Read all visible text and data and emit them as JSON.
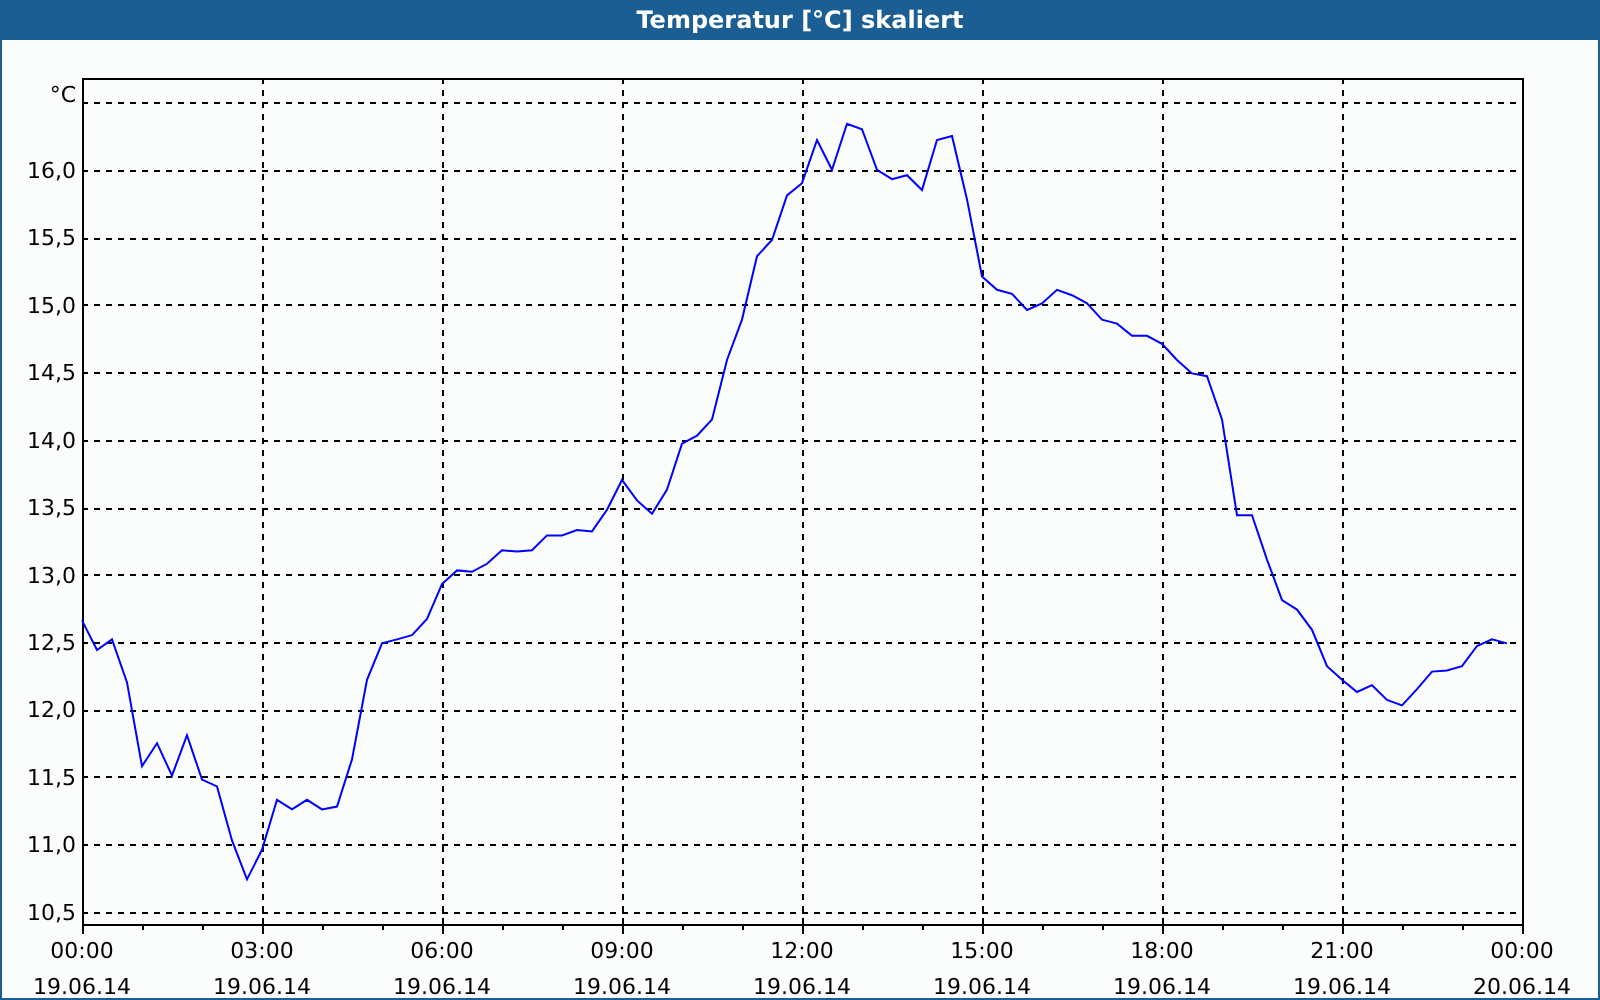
{
  "window": {
    "title": "Temperatur [°C] skaliert"
  },
  "chart": {
    "chart_data": {
      "type": "line",
      "grid": true,
      "ylabel": "°C",
      "ylim": [
        10.41,
        16.68
      ],
      "yticks": [
        {
          "value": 10.5,
          "label": "10,5"
        },
        {
          "value": 11,
          "label": "11,0"
        },
        {
          "value": 11.5,
          "label": "11,5"
        },
        {
          "value": 12,
          "label": "12,0"
        },
        {
          "value": 12.5,
          "label": "12,5"
        },
        {
          "value": 13,
          "label": "13,0"
        },
        {
          "value": 13.5,
          "label": "13,5"
        },
        {
          "value": 14,
          "label": "14,0"
        },
        {
          "value": 14.5,
          "label": "14,5"
        },
        {
          "value": 15,
          "label": "15,0"
        },
        {
          "value": 15.5,
          "label": "15,5"
        },
        {
          "value": 16,
          "label": "16,0"
        }
      ],
      "categories": [
        "00:00\n19.06.14",
        null,
        null,
        null,
        null,
        null,
        null,
        null,
        null,
        null,
        null,
        null,
        "03:00\n19.06.14",
        null,
        null,
        null,
        null,
        null,
        null,
        null,
        null,
        null,
        null,
        null,
        "06:00\n19.06.14",
        null,
        null,
        null,
        null,
        null,
        null,
        null,
        null,
        null,
        null,
        null,
        "09:00\n19.06.14",
        null,
        null,
        null,
        null,
        null,
        null,
        null,
        null,
        null,
        null,
        null,
        "12:00\n19.06.14",
        null,
        null,
        null,
        null,
        null,
        null,
        null,
        null,
        null,
        null,
        null,
        "15:00\n19.06.14",
        null,
        null,
        null,
        null,
        null,
        null,
        null,
        null,
        null,
        null,
        null,
        "18:00\n19.06.14",
        null,
        null,
        null,
        null,
        null,
        null,
        null,
        null,
        null,
        null,
        null,
        "21:00\n19.06.14",
        null,
        null,
        null,
        null,
        null,
        null,
        null,
        null,
        null,
        null,
        null,
        "00:00\n20.06.14"
      ],
      "series": [
        {
          "color": "#0000ff",
          "values": [
            12.66,
            12.44,
            12.52,
            12.2,
            11.58,
            11.75,
            11.51,
            11.81,
            11.48,
            11.43,
            11.03,
            10.74,
            10.96,
            11.33,
            11.26,
            11.33,
            11.26,
            11.28,
            11.63,
            12.22,
            12.49,
            12.52,
            12.55,
            12.67,
            12.93,
            13.03,
            13.02,
            13.08,
            13.18,
            13.17,
            13.18,
            13.29,
            13.29,
            13.33,
            13.32,
            13.48,
            13.7,
            13.55,
            13.45,
            13.63,
            13.97,
            14.03,
            14.15,
            14.59,
            14.89,
            15.36,
            15.48,
            15.81,
            15.9,
            16.22,
            16.0,
            16.34,
            16.3,
            16.0,
            15.93,
            15.96,
            15.85,
            16.22,
            16.25,
            15.78,
            15.21,
            15.11,
            15.08,
            14.96,
            15.01,
            15.11,
            15.07,
            15.01,
            14.89,
            14.86,
            14.77,
            14.77,
            14.71,
            14.59,
            14.49,
            14.47,
            14.15,
            13.44,
            13.44,
            13.11,
            12.81,
            12.74,
            12.59,
            12.32,
            12.22,
            12.13,
            12.18,
            12.07,
            12.03,
            12.15,
            12.28,
            12.29,
            12.32,
            12.47,
            12.52,
            12.49,
            null
          ]
        }
      ]
    }
  }
}
